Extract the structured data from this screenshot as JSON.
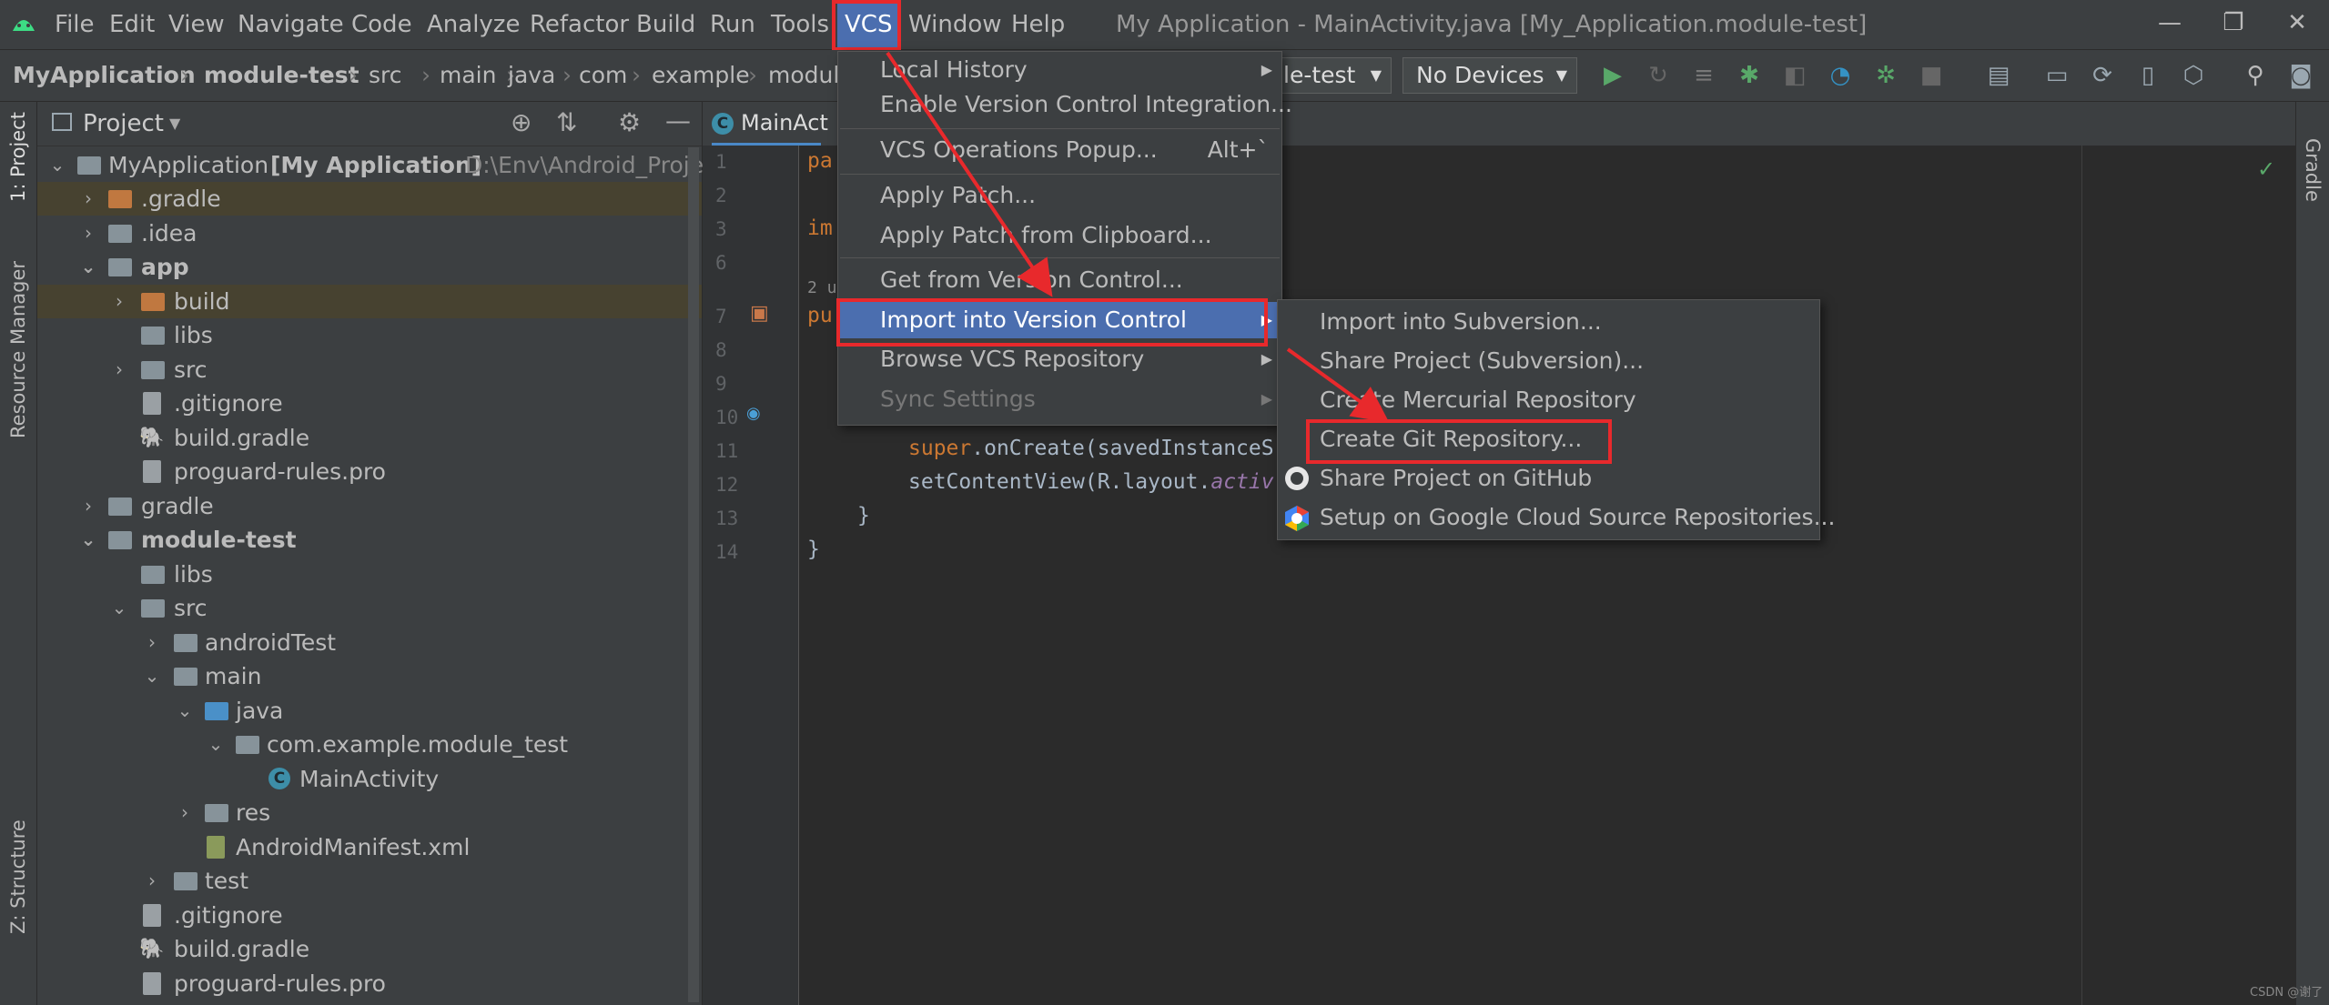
{
  "app": {
    "window_title": "My Application - MainActivity.java [My_Application.module-test]"
  },
  "menubar": {
    "items": [
      "File",
      "Edit",
      "View",
      "Navigate",
      "Code",
      "Analyze",
      "Refactor",
      "Build",
      "Run",
      "Tools",
      "VCS",
      "Window",
      "Help"
    ],
    "active": "VCS"
  },
  "breadcrumb": [
    "MyApplication",
    "module-test",
    "src",
    "main",
    "java",
    "com",
    "example",
    "modul"
  ],
  "toolbar": {
    "config_combo": "le-test",
    "device_combo": "No Devices"
  },
  "left_strip": {
    "project_tab": "1: Project",
    "resource_tab": "Resource Manager",
    "structure_tab": "Z: Structure"
  },
  "right_strip": {
    "gradle_tab": "Gradle"
  },
  "project_panel": {
    "title": "Project",
    "tree": [
      {
        "label": "MyApplication",
        "bold_suffix": "[My Application]",
        "path": "D:\\Env\\Android_Project"
      },
      {
        "label": ".gradle"
      },
      {
        "label": ".idea"
      },
      {
        "label": "app"
      },
      {
        "label": "build"
      },
      {
        "label": "libs"
      },
      {
        "label": "src"
      },
      {
        "label": ".gitignore"
      },
      {
        "label": "build.gradle"
      },
      {
        "label": "proguard-rules.pro"
      },
      {
        "label": "gradle"
      },
      {
        "label": "module-test"
      },
      {
        "label": "libs"
      },
      {
        "label": "src"
      },
      {
        "label": "androidTest"
      },
      {
        "label": "main"
      },
      {
        "label": "java"
      },
      {
        "label": "com.example.module_test"
      },
      {
        "label": "MainActivity"
      },
      {
        "label": "res"
      },
      {
        "label": "AndroidManifest.xml"
      },
      {
        "label": "test"
      },
      {
        "label": ".gitignore"
      },
      {
        "label": "build.gradle"
      },
      {
        "label": "proguard-rules.pro"
      }
    ]
  },
  "editor": {
    "tab_label": "MainAct",
    "line_numbers": [
      "1",
      "2",
      "3",
      "6",
      "7",
      "8",
      "9",
      "10",
      "11",
      "12",
      "13",
      "14"
    ],
    "lines": {
      "l1": "pa",
      "l3": "im",
      "hint": "2 u",
      "l7": "pu",
      "l11a": "super",
      "l11b": ".onCreate(savedInstanceS",
      "l12a": "setContentView(R.layout.",
      "l12b": "activ",
      "l13": "}",
      "l14": "}"
    }
  },
  "vcs_menu": {
    "items": [
      {
        "label": "Local History",
        "submenu": true
      },
      {
        "label": "Enable Version Control Integration...",
        "submenu": false
      },
      {
        "label": "VCS Operations Popup...",
        "shortcut": "Alt+`"
      },
      {
        "label": "Apply Patch..."
      },
      {
        "label": "Apply Patch from Clipboard..."
      },
      {
        "label": "Get from Version Control..."
      },
      {
        "label": "Import into Version Control",
        "submenu": true,
        "selected": true
      },
      {
        "label": "Browse VCS Repository",
        "submenu": true
      },
      {
        "label": "Sync Settings",
        "submenu": true,
        "disabled": true
      }
    ]
  },
  "import_submenu": {
    "items": [
      {
        "label": "Import into Subversion..."
      },
      {
        "label": "Share Project (Subversion)..."
      },
      {
        "label": "Create Mercurial Repository"
      },
      {
        "label": "Create Git Repository..."
      },
      {
        "label": "Share Project on GitHub",
        "icon": "github-icon"
      },
      {
        "label": "Setup on Google Cloud Source Repositories...",
        "icon": "google-cloud-icon"
      }
    ]
  },
  "watermark": "CSDN @谢了",
  "colors": {
    "selection": "#4b6eaf",
    "annotation_red": "#e8292c",
    "background": "#2b2b2b",
    "panel": "#3c3f41"
  }
}
